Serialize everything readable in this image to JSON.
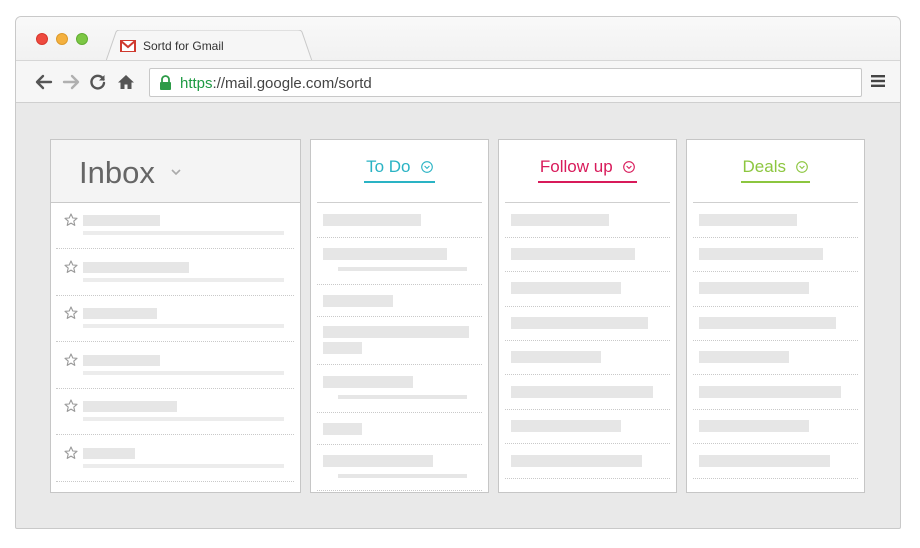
{
  "browser": {
    "tab_title": "Sortd for Gmail",
    "url_scheme": "https",
    "url_rest": "://mail.google.com/sortd"
  },
  "icons": {
    "gmail": "gmail-icon",
    "back": "arrow-left-icon",
    "forward": "arrow-right-icon",
    "reload": "reload-icon",
    "home": "home-icon",
    "lock": "lock-icon",
    "menu": "hamburger-menu-icon",
    "star": "star-icon",
    "dropdown": "chevron-down-icon"
  },
  "inbox": {
    "title": "Inbox",
    "row_count": 6
  },
  "columns": {
    "todo": {
      "label": "To Do",
      "color": "#2ab3c4"
    },
    "follow_up": {
      "label": "Follow up",
      "color": "#d81a5a"
    },
    "deals": {
      "label": "Deals",
      "color": "#8cc63f"
    }
  },
  "colors": {
    "placeholder": "#e6e6e6",
    "secure_url": "#1e9a43"
  }
}
